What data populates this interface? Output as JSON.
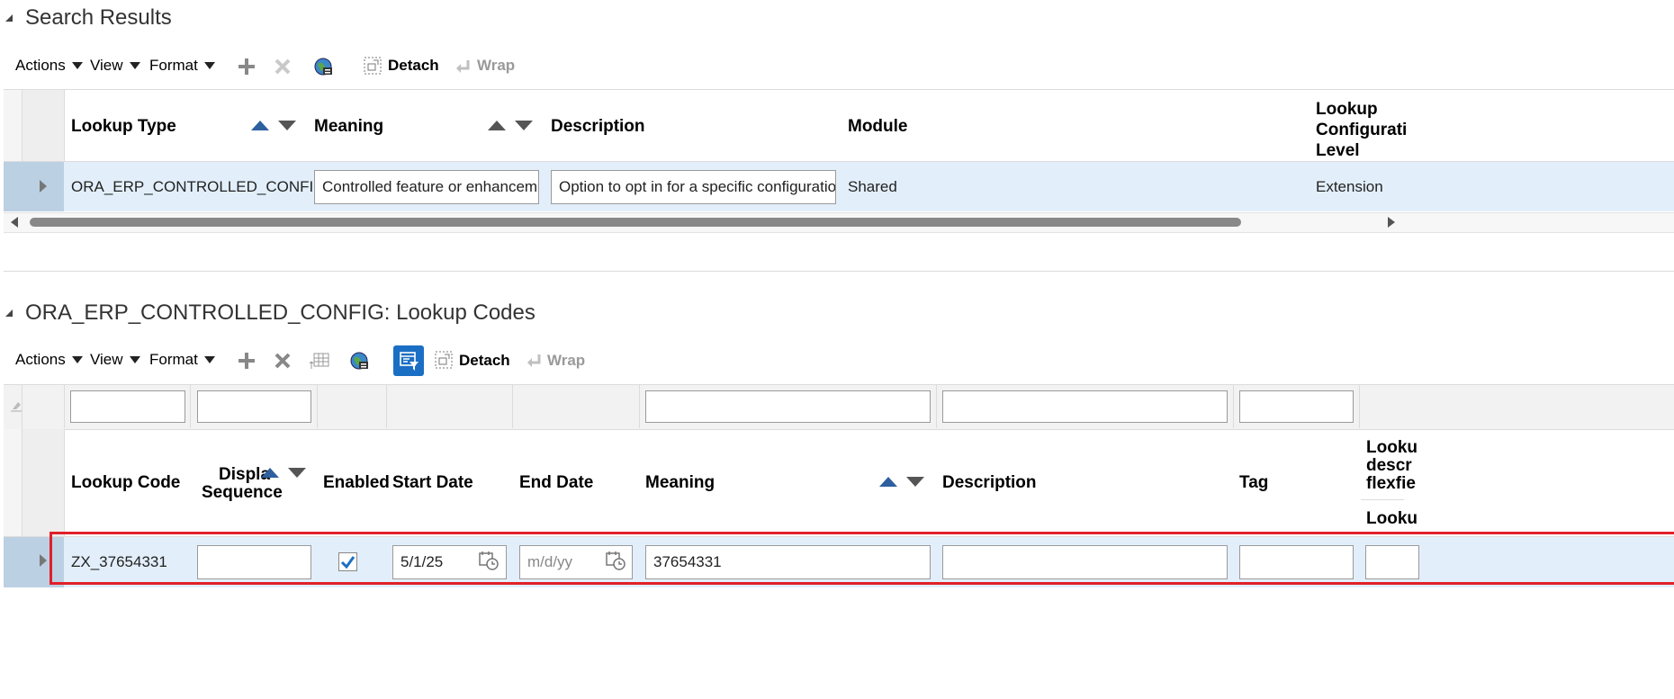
{
  "search_results": {
    "title": "Search Results",
    "toolbar": {
      "actions": "Actions",
      "view": "View",
      "format": "Format",
      "detach": "Detach",
      "wrap": "Wrap"
    },
    "columns": {
      "lookup_type": "Lookup Type",
      "meaning": "Meaning",
      "description": "Description",
      "module": "Module",
      "config_level": "Lookup Configuration Level"
    },
    "row": {
      "lookup_type": "ORA_ERP_CONTROLLED_CONFIG",
      "meaning": "Controlled feature or enhancement",
      "description": "Option to opt in for a specific configuration in",
      "module": "Shared",
      "config_level": "Extension"
    }
  },
  "lookup_codes": {
    "title": "ORA_ERP_CONTROLLED_CONFIG: Lookup Codes",
    "toolbar": {
      "actions": "Actions",
      "view": "View",
      "format": "Format",
      "detach": "Detach",
      "wrap": "Wrap"
    },
    "columns": {
      "lookup_code": "Lookup Code",
      "display_sequence_1": "Displa",
      "display_sequence_2": "Sequence",
      "enabled": "Enabled",
      "start_date": "Start Date",
      "end_date": "End Date",
      "meaning": "Meaning",
      "description": "Description",
      "tag": "Tag",
      "flex_1": "Looku",
      "flex_2": "descr",
      "flex_3": "flexfie",
      "flex_sub": "Looku"
    },
    "row": {
      "lookup_code": "ZX_37654331",
      "display_sequence": "",
      "enabled": true,
      "start_date": "5/1/25",
      "end_date_placeholder": "m/d/yy",
      "meaning": "37654331",
      "description": "",
      "tag": ""
    }
  },
  "colors": {
    "selected_row": "#e2effa",
    "highlight_border": "#e0202a",
    "accent_blue": "#1a6fc4"
  }
}
